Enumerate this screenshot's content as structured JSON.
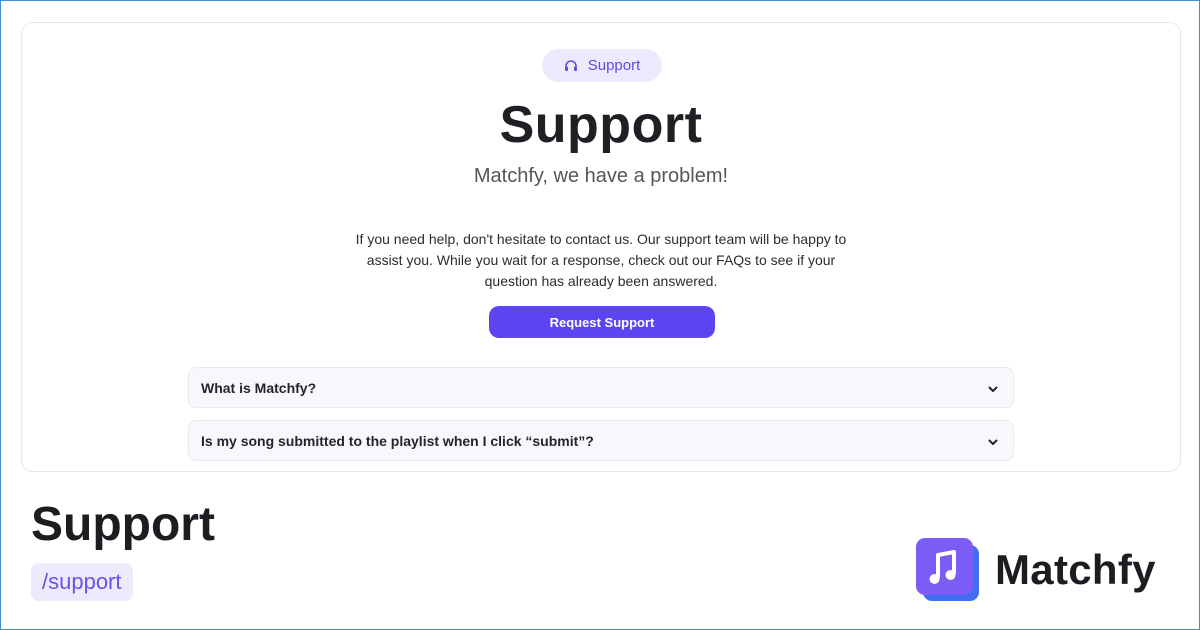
{
  "preview": {
    "chip": {
      "icon": "headset-icon",
      "label": "Support"
    },
    "title": "Support",
    "subtitle": "Matchfy, we have a problem!",
    "intro": "If you need help, don't hesitate to contact us. Our support team will be happy to assist you. While you wait for a response, check out our FAQs to see if your question has already been answered.",
    "request_button": "Request Support",
    "faqs": [
      {
        "question": "What is Matchfy?",
        "icon": "chevron-down-icon"
      },
      {
        "question": "Is my song submitted to the playlist when I click “submit”?",
        "icon": "chevron-down-icon"
      }
    ]
  },
  "caption": {
    "title": "Support",
    "route": "/support"
  },
  "brand": {
    "logo_icon": "music-note-icon",
    "name": "Matchfy"
  },
  "colors": {
    "accent": "#5b45f2",
    "chip_background": "#eeeafe",
    "frame_border": "#3d8fd6",
    "logo_back": "#3f6ef0",
    "logo_front": "#7b5cf5"
  }
}
